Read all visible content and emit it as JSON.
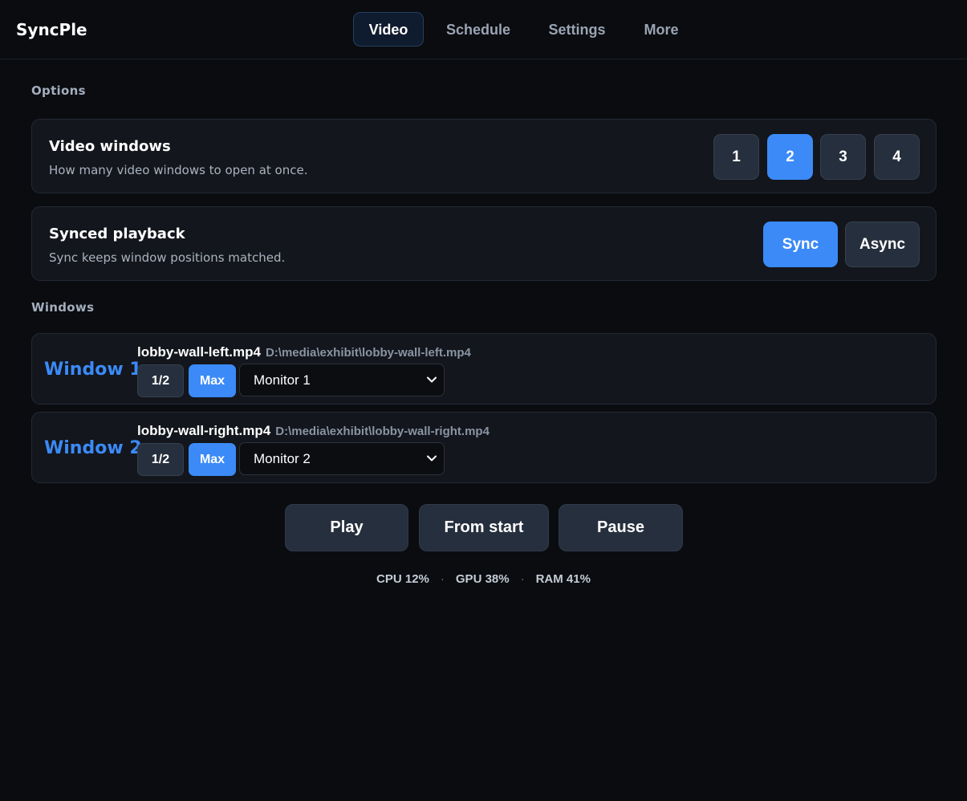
{
  "app": {
    "title": "SyncPle"
  },
  "nav": {
    "tabs": [
      {
        "label": "Video",
        "active": true
      },
      {
        "label": "Schedule",
        "active": false
      },
      {
        "label": "Settings",
        "active": false
      },
      {
        "label": "More",
        "active": false
      }
    ]
  },
  "options": {
    "section_label": "Options",
    "video_windows": {
      "title": "Video windows",
      "description": "How many video windows to open at once.",
      "choices": [
        "1",
        "2",
        "3",
        "4"
      ],
      "selected": "2"
    },
    "synced_playback": {
      "title": "Synced playback",
      "description": "Sync keeps window positions matched.",
      "choices": [
        "Sync",
        "Async"
      ],
      "selected": "Sync"
    }
  },
  "windows": {
    "section_label": "Windows",
    "items": [
      {
        "label": "Window 1",
        "file_name": "lobby-wall-left.mp4",
        "file_path": "D:\\media\\exhibit\\lobby-wall-left.mp4",
        "size_half": "1/2",
        "size_max": "Max",
        "size_selected": "Max",
        "monitor": "Monitor 1"
      },
      {
        "label": "Window 2",
        "file_name": "lobby-wall-right.mp4",
        "file_path": "D:\\media\\exhibit\\lobby-wall-right.mp4",
        "size_half": "1/2",
        "size_max": "Max",
        "size_selected": "Max",
        "monitor": "Monitor 2"
      }
    ]
  },
  "actions": {
    "play": "Play",
    "from_start": "From start",
    "pause": "Pause"
  },
  "stats": {
    "cpu": "CPU 12%",
    "gpu": "GPU 38%",
    "ram": "RAM 41%",
    "separator": "·"
  },
  "colors": {
    "accent": "#3b8af7",
    "background": "#0a0c10",
    "card": "#13161c",
    "button": "#262f3d"
  },
  "icons": {
    "select_chevron": "chevron-down-icon"
  }
}
